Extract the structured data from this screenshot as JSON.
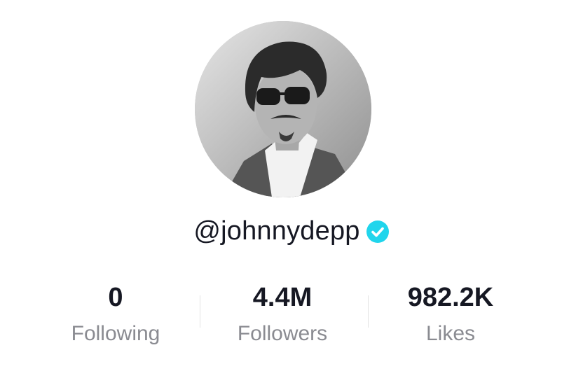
{
  "profile": {
    "avatar_icon": "profile-photo",
    "handle": "@johnnydepp",
    "verified_icon": "verified-badge-icon",
    "verified_color": "#20d5ec"
  },
  "stats": [
    {
      "value": "0",
      "label": "Following"
    },
    {
      "value": "4.4M",
      "label": "Followers"
    },
    {
      "value": "982.2K",
      "label": "Likes"
    }
  ]
}
